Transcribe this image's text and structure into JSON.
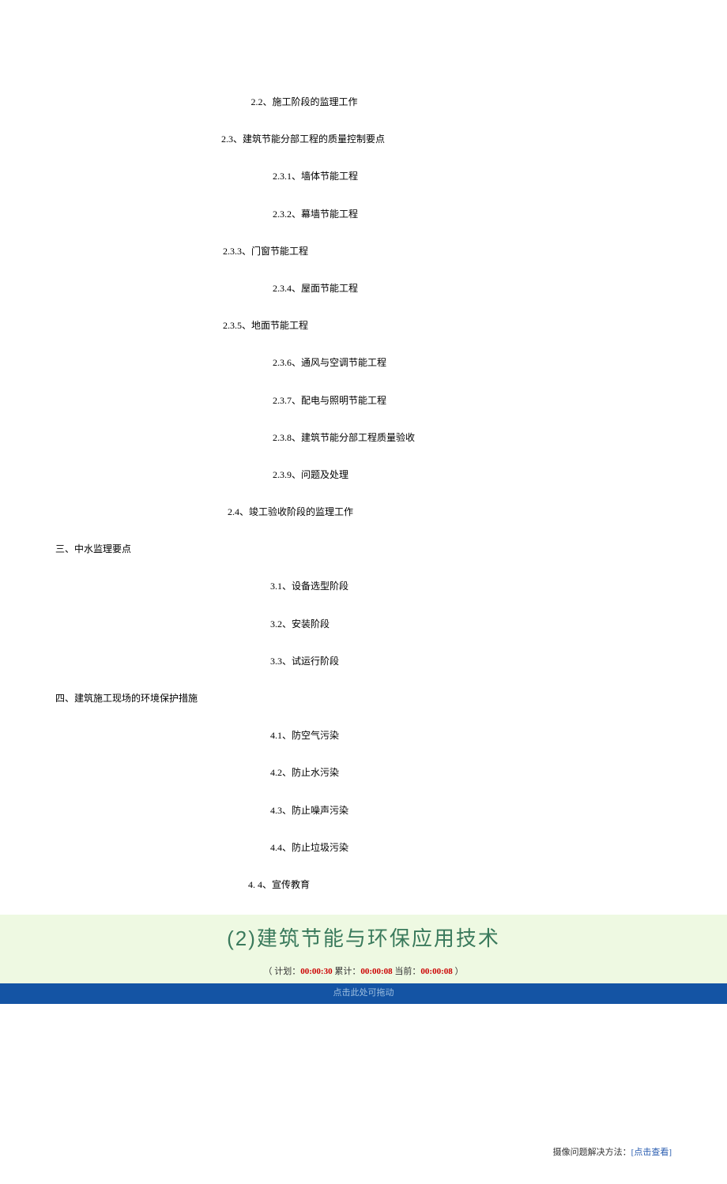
{
  "toc": {
    "i1": "2.2、施工阶段的监理工作",
    "i2": "2.3、建筑节能分部工程的质量控制要点",
    "i3": "2.3.1、墙体节能工程",
    "i4": "2.3.2、幕墙节能工程",
    "i5": "2.3.3、门窗节能工程",
    "i6": "2.3.4、屋面节能工程",
    "i7": "2.3.5、地面节能工程",
    "i8": "2.3.6、通风与空调节能工程",
    "i9": "2.3.7、配电与照明节能工程",
    "i10": "2.3.8、建筑节能分部工程质量验收",
    "i11": "2.3.9、问题及处理",
    "i12": "2.4、竣工验收阶段的监理工作",
    "i13": "三、中水监理要点",
    "i14": "3.1、设备选型阶段",
    "i15": "3.2、安装阶段",
    "i16": "3.3、试运行阶段",
    "i17": "四、建筑施工现场的环境保护措施",
    "i18": "4.1、防空气污染",
    "i19": "4.2、防止水污染",
    "i20": "4.3、防止噪声污染",
    "i21": "4.4、防止垃圾污染",
    "i22": "4. 4、宣传教育"
  },
  "section": {
    "title": "(2)建筑节能与环保应用技术"
  },
  "timer": {
    "plan_label": "（ 计划：",
    "plan_value": "00:00:30",
    "total_label": " 累计：",
    "total_value": "00:00:08",
    "current_label": " 当前：",
    "current_value": "00:00:08",
    "suffix": " ）"
  },
  "dragbar": {
    "text": "点击此处可拖动"
  },
  "footer": {
    "label": "摄像问题解决方法：",
    "link": "[点击查看]"
  }
}
